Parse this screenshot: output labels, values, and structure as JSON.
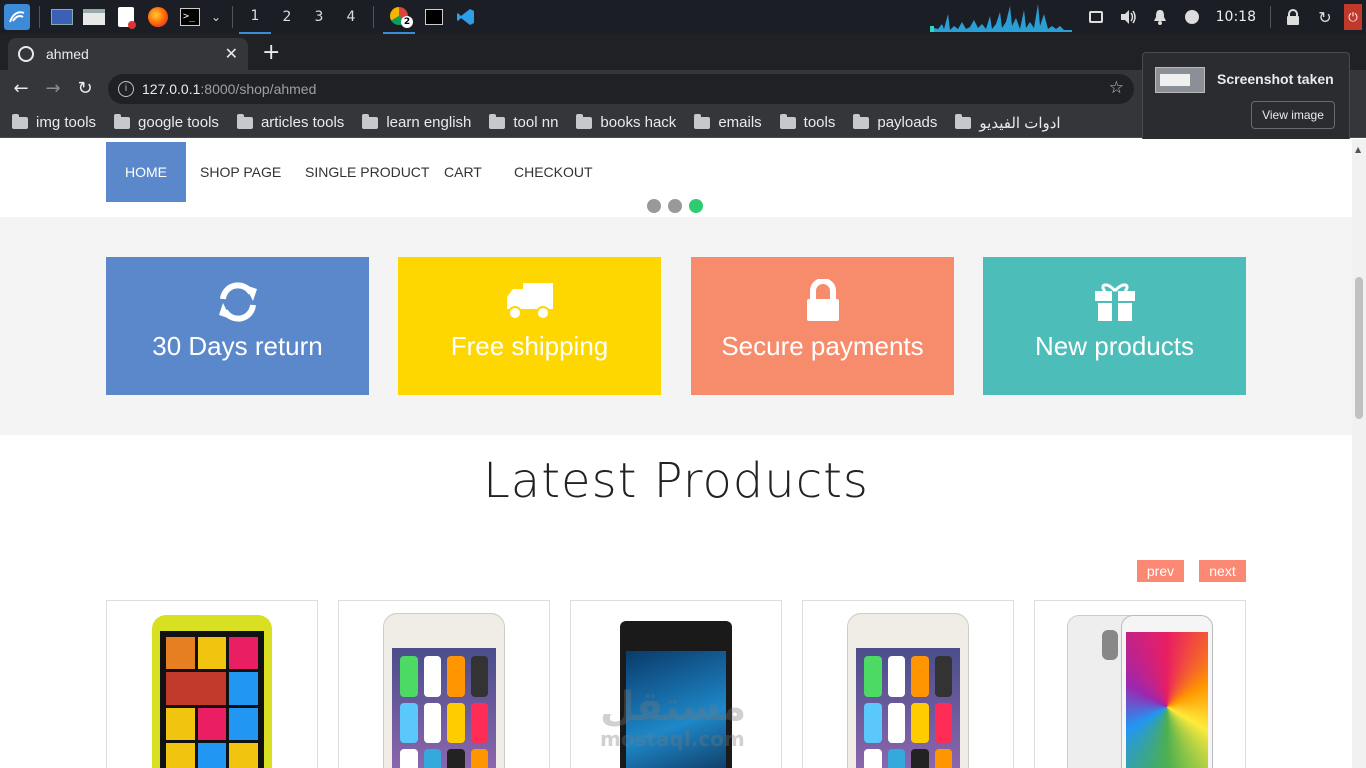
{
  "taskbar": {
    "workspaces": [
      "1",
      "2",
      "3",
      "4"
    ],
    "clock": "10:18",
    "chrome_badge": "2"
  },
  "browser": {
    "tab_title": "ahmed",
    "url_host": "127.0.0.1",
    "url_path": ":8000/shop/ahmed",
    "bookmarks": [
      "img tools",
      "google tools",
      "articles tools",
      "learn english",
      "tool nn",
      "books hack",
      "emails",
      "tools",
      "payloads",
      "ادوات الفيديو"
    ],
    "notification": {
      "title": "Screenshot taken",
      "button": "View image"
    }
  },
  "page": {
    "menu": [
      "Home",
      "Shop page",
      "Single product",
      "Cart",
      "Checkout"
    ],
    "promos": [
      {
        "label": "30 Days return",
        "color": "#5a88ca",
        "icon": "refresh-icon"
      },
      {
        "label": "Free shipping",
        "color": "#fed700",
        "icon": "truck-icon"
      },
      {
        "label": "Secure payments",
        "color": "#f78c6c",
        "icon": "lock-icon"
      },
      {
        "label": "New products",
        "color": "#4dbdb9",
        "icon": "gift-icon"
      }
    ],
    "latest_title": "Latest Products",
    "prev_label": "prev",
    "next_label": "next",
    "watermark": "مستقل",
    "watermark_sub": "mostaql.com"
  }
}
